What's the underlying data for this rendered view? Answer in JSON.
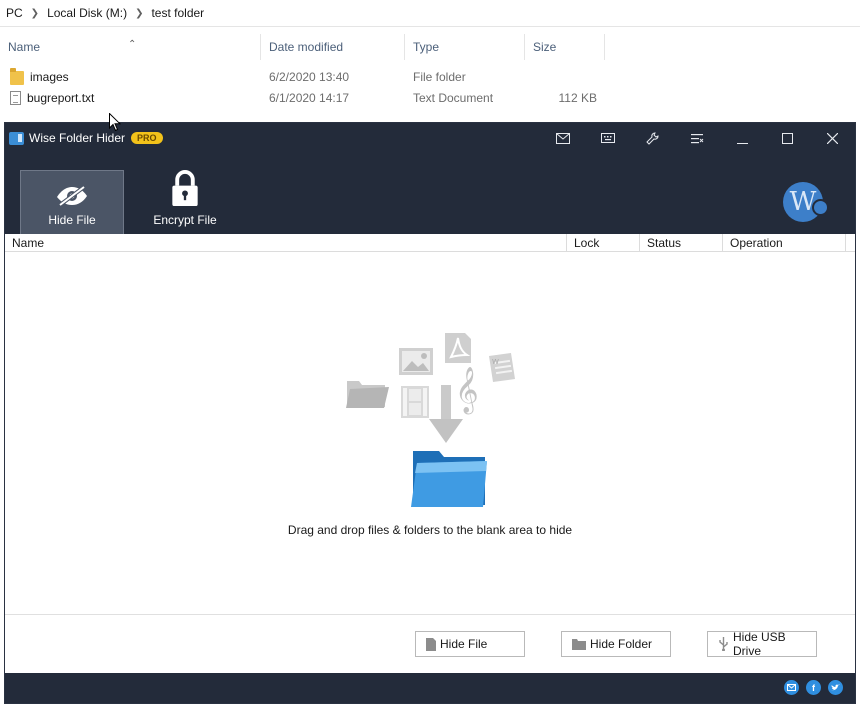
{
  "explorer": {
    "breadcrumb": [
      "PC",
      "Local Disk (M:)",
      "test folder"
    ],
    "columns": [
      "Name",
      "Date modified",
      "Type",
      "Size"
    ],
    "files": [
      {
        "name": "images",
        "date": "6/2/2020 13:40",
        "type": "File folder",
        "size": "",
        "icon": "folder-icon"
      },
      {
        "name": "bugreport.txt",
        "date": "6/1/2020 14:17",
        "type": "Text Document",
        "size": "112 KB",
        "icon": "text-file-icon"
      }
    ]
  },
  "app": {
    "title": "Wise Folder Hider",
    "badge": "PRO",
    "titlebar_icons": [
      "mail-icon",
      "keyboard-icon",
      "wrench-icon",
      "menu-icon",
      "minimize-icon",
      "maximize-icon",
      "close-icon"
    ],
    "tools": {
      "hide_file": "Hide File",
      "encrypt_file": "Encrypt File"
    },
    "avatar_letter": "W",
    "list_columns": [
      "Name",
      "Lock",
      "Status",
      "Operation"
    ],
    "drop_hint": "Drag and drop files & folders to the blank area to hide",
    "buttons": {
      "hide_file": "Hide File",
      "hide_folder": "Hide Folder",
      "hide_usb": "Hide USB Drive"
    },
    "social": [
      "email-icon",
      "facebook-icon",
      "twitter-icon"
    ],
    "colors": {
      "chrome": "#232b3a",
      "active_tab": "#4b5566",
      "badge": "#f2c21a",
      "accent": "#3d7fc9"
    }
  }
}
